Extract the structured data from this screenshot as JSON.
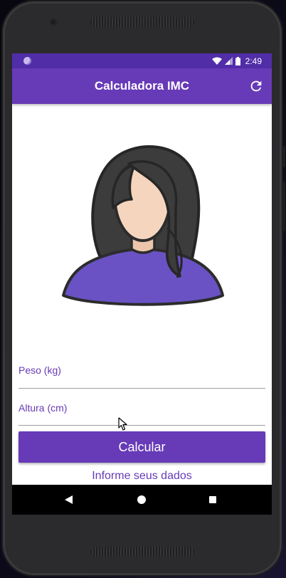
{
  "status_bar": {
    "time": "2:49"
  },
  "app_bar": {
    "title": "Calculadora IMC",
    "refresh_icon": "refresh-icon"
  },
  "avatar": {
    "icon": "female-avatar-icon",
    "colors": {
      "hair": "#3b3b3b",
      "skin": "#f6d5bf",
      "shirt": "#6a52c4"
    }
  },
  "form": {
    "peso_label": "Peso (kg)",
    "altura_label": "Altura (cm)",
    "peso_value": "",
    "altura_value": ""
  },
  "calcular_label": "Calcular",
  "info_text": "Informe seus dados",
  "colors": {
    "primary": "#673ab7",
    "primary_dark": "#512da8"
  }
}
